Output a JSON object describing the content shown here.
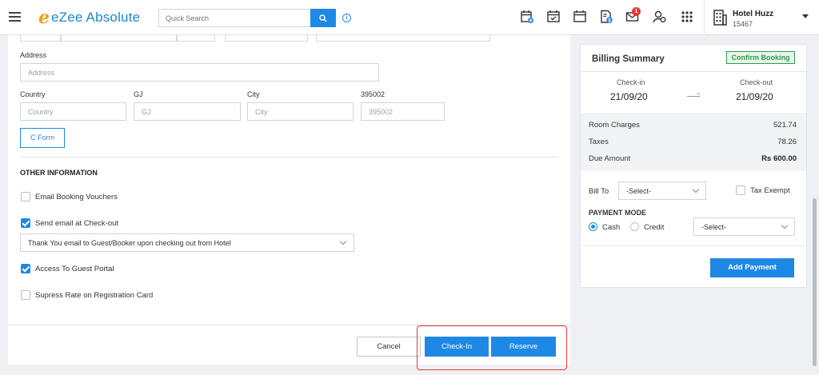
{
  "header": {
    "logo_text": "eZee Absolute",
    "search_placeholder": "Quick Search",
    "notification_count": "1",
    "hotel_name": "Hotel Huzz",
    "hotel_code": "15467"
  },
  "address": {
    "label": "Address",
    "placeholder": "Address",
    "country_label": "Country",
    "country_placeholder": "Country",
    "state_label": "GJ",
    "state_placeholder": "GJ",
    "city_label": "City",
    "city_placeholder": "City",
    "zip_label": "395002",
    "zip_placeholder": "395002",
    "cform_label": "C Form"
  },
  "other_info": {
    "title": "OTHER INFORMATION",
    "email_vouchers": {
      "label": "Email Booking Vouchers",
      "checked": false
    },
    "send_email_checkout": {
      "label": "Send email at Check-out",
      "checked": true
    },
    "email_template": "Thank You email to Guest/Booker upon checking out from Hotel",
    "guest_portal": {
      "label": "Access To Guest Portal",
      "checked": true
    },
    "supress_rate": {
      "label": "Supress Rate on Registration Card",
      "checked": false
    }
  },
  "footer": {
    "cancel_label": "Cancel",
    "checkin_label": "Check-In",
    "reserve_label": "Reserve"
  },
  "billing": {
    "title": "Billing Summary",
    "status": "Confirm Booking",
    "checkin_label": "Check-in",
    "checkin_date": "21/09/20",
    "checkout_label": "Check-out",
    "checkout_date": "21/09/20",
    "room_charges_label": "Room Charges",
    "room_charges": "521.74",
    "taxes_label": "Taxes",
    "taxes": "78.26",
    "due_label": "Due Amount",
    "due": "Rs 600.00",
    "bill_to_label": "Bill To",
    "bill_to_value": "-Select-",
    "tax_exempt_label": "Tax Exempt",
    "payment_mode_label": "PAYMENT MODE",
    "cash_label": "Cash",
    "credit_label": "Credit",
    "payment_select": "-Select-",
    "add_payment_label": "Add Payment"
  },
  "colors": {
    "primary": "#1e88e5",
    "confirm_green": "#2e9b4a",
    "highlight_red": "#e53935"
  }
}
